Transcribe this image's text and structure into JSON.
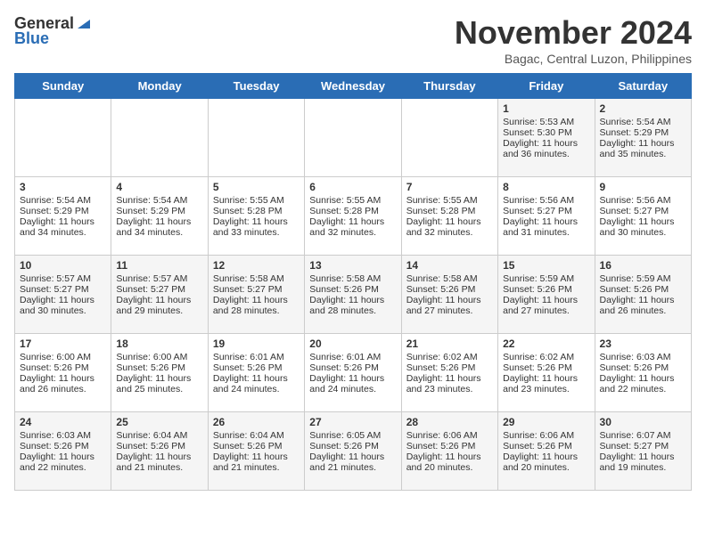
{
  "header": {
    "logo_general": "General",
    "logo_blue": "Blue",
    "month_title": "November 2024",
    "location": "Bagac, Central Luzon, Philippines"
  },
  "days_of_week": [
    "Sunday",
    "Monday",
    "Tuesday",
    "Wednesday",
    "Thursday",
    "Friday",
    "Saturday"
  ],
  "weeks": [
    [
      {
        "day": "",
        "sunrise": "",
        "sunset": "",
        "daylight": ""
      },
      {
        "day": "",
        "sunrise": "",
        "sunset": "",
        "daylight": ""
      },
      {
        "day": "",
        "sunrise": "",
        "sunset": "",
        "daylight": ""
      },
      {
        "day": "",
        "sunrise": "",
        "sunset": "",
        "daylight": ""
      },
      {
        "day": "",
        "sunrise": "",
        "sunset": "",
        "daylight": ""
      },
      {
        "day": "1",
        "sunrise": "Sunrise: 5:53 AM",
        "sunset": "Sunset: 5:30 PM",
        "daylight": "Daylight: 11 hours and 36 minutes."
      },
      {
        "day": "2",
        "sunrise": "Sunrise: 5:54 AM",
        "sunset": "Sunset: 5:29 PM",
        "daylight": "Daylight: 11 hours and 35 minutes."
      }
    ],
    [
      {
        "day": "3",
        "sunrise": "Sunrise: 5:54 AM",
        "sunset": "Sunset: 5:29 PM",
        "daylight": "Daylight: 11 hours and 34 minutes."
      },
      {
        "day": "4",
        "sunrise": "Sunrise: 5:54 AM",
        "sunset": "Sunset: 5:29 PM",
        "daylight": "Daylight: 11 hours and 34 minutes."
      },
      {
        "day": "5",
        "sunrise": "Sunrise: 5:55 AM",
        "sunset": "Sunset: 5:28 PM",
        "daylight": "Daylight: 11 hours and 33 minutes."
      },
      {
        "day": "6",
        "sunrise": "Sunrise: 5:55 AM",
        "sunset": "Sunset: 5:28 PM",
        "daylight": "Daylight: 11 hours and 32 minutes."
      },
      {
        "day": "7",
        "sunrise": "Sunrise: 5:55 AM",
        "sunset": "Sunset: 5:28 PM",
        "daylight": "Daylight: 11 hours and 32 minutes."
      },
      {
        "day": "8",
        "sunrise": "Sunrise: 5:56 AM",
        "sunset": "Sunset: 5:27 PM",
        "daylight": "Daylight: 11 hours and 31 minutes."
      },
      {
        "day": "9",
        "sunrise": "Sunrise: 5:56 AM",
        "sunset": "Sunset: 5:27 PM",
        "daylight": "Daylight: 11 hours and 30 minutes."
      }
    ],
    [
      {
        "day": "10",
        "sunrise": "Sunrise: 5:57 AM",
        "sunset": "Sunset: 5:27 PM",
        "daylight": "Daylight: 11 hours and 30 minutes."
      },
      {
        "day": "11",
        "sunrise": "Sunrise: 5:57 AM",
        "sunset": "Sunset: 5:27 PM",
        "daylight": "Daylight: 11 hours and 29 minutes."
      },
      {
        "day": "12",
        "sunrise": "Sunrise: 5:58 AM",
        "sunset": "Sunset: 5:27 PM",
        "daylight": "Daylight: 11 hours and 28 minutes."
      },
      {
        "day": "13",
        "sunrise": "Sunrise: 5:58 AM",
        "sunset": "Sunset: 5:26 PM",
        "daylight": "Daylight: 11 hours and 28 minutes."
      },
      {
        "day": "14",
        "sunrise": "Sunrise: 5:58 AM",
        "sunset": "Sunset: 5:26 PM",
        "daylight": "Daylight: 11 hours and 27 minutes."
      },
      {
        "day": "15",
        "sunrise": "Sunrise: 5:59 AM",
        "sunset": "Sunset: 5:26 PM",
        "daylight": "Daylight: 11 hours and 27 minutes."
      },
      {
        "day": "16",
        "sunrise": "Sunrise: 5:59 AM",
        "sunset": "Sunset: 5:26 PM",
        "daylight": "Daylight: 11 hours and 26 minutes."
      }
    ],
    [
      {
        "day": "17",
        "sunrise": "Sunrise: 6:00 AM",
        "sunset": "Sunset: 5:26 PM",
        "daylight": "Daylight: 11 hours and 26 minutes."
      },
      {
        "day": "18",
        "sunrise": "Sunrise: 6:00 AM",
        "sunset": "Sunset: 5:26 PM",
        "daylight": "Daylight: 11 hours and 25 minutes."
      },
      {
        "day": "19",
        "sunrise": "Sunrise: 6:01 AM",
        "sunset": "Sunset: 5:26 PM",
        "daylight": "Daylight: 11 hours and 24 minutes."
      },
      {
        "day": "20",
        "sunrise": "Sunrise: 6:01 AM",
        "sunset": "Sunset: 5:26 PM",
        "daylight": "Daylight: 11 hours and 24 minutes."
      },
      {
        "day": "21",
        "sunrise": "Sunrise: 6:02 AM",
        "sunset": "Sunset: 5:26 PM",
        "daylight": "Daylight: 11 hours and 23 minutes."
      },
      {
        "day": "22",
        "sunrise": "Sunrise: 6:02 AM",
        "sunset": "Sunset: 5:26 PM",
        "daylight": "Daylight: 11 hours and 23 minutes."
      },
      {
        "day": "23",
        "sunrise": "Sunrise: 6:03 AM",
        "sunset": "Sunset: 5:26 PM",
        "daylight": "Daylight: 11 hours and 22 minutes."
      }
    ],
    [
      {
        "day": "24",
        "sunrise": "Sunrise: 6:03 AM",
        "sunset": "Sunset: 5:26 PM",
        "daylight": "Daylight: 11 hours and 22 minutes."
      },
      {
        "day": "25",
        "sunrise": "Sunrise: 6:04 AM",
        "sunset": "Sunset: 5:26 PM",
        "daylight": "Daylight: 11 hours and 21 minutes."
      },
      {
        "day": "26",
        "sunrise": "Sunrise: 6:04 AM",
        "sunset": "Sunset: 5:26 PM",
        "daylight": "Daylight: 11 hours and 21 minutes."
      },
      {
        "day": "27",
        "sunrise": "Sunrise: 6:05 AM",
        "sunset": "Sunset: 5:26 PM",
        "daylight": "Daylight: 11 hours and 21 minutes."
      },
      {
        "day": "28",
        "sunrise": "Sunrise: 6:06 AM",
        "sunset": "Sunset: 5:26 PM",
        "daylight": "Daylight: 11 hours and 20 minutes."
      },
      {
        "day": "29",
        "sunrise": "Sunrise: 6:06 AM",
        "sunset": "Sunset: 5:26 PM",
        "daylight": "Daylight: 11 hours and 20 minutes."
      },
      {
        "day": "30",
        "sunrise": "Sunrise: 6:07 AM",
        "sunset": "Sunset: 5:27 PM",
        "daylight": "Daylight: 11 hours and 19 minutes."
      }
    ]
  ]
}
